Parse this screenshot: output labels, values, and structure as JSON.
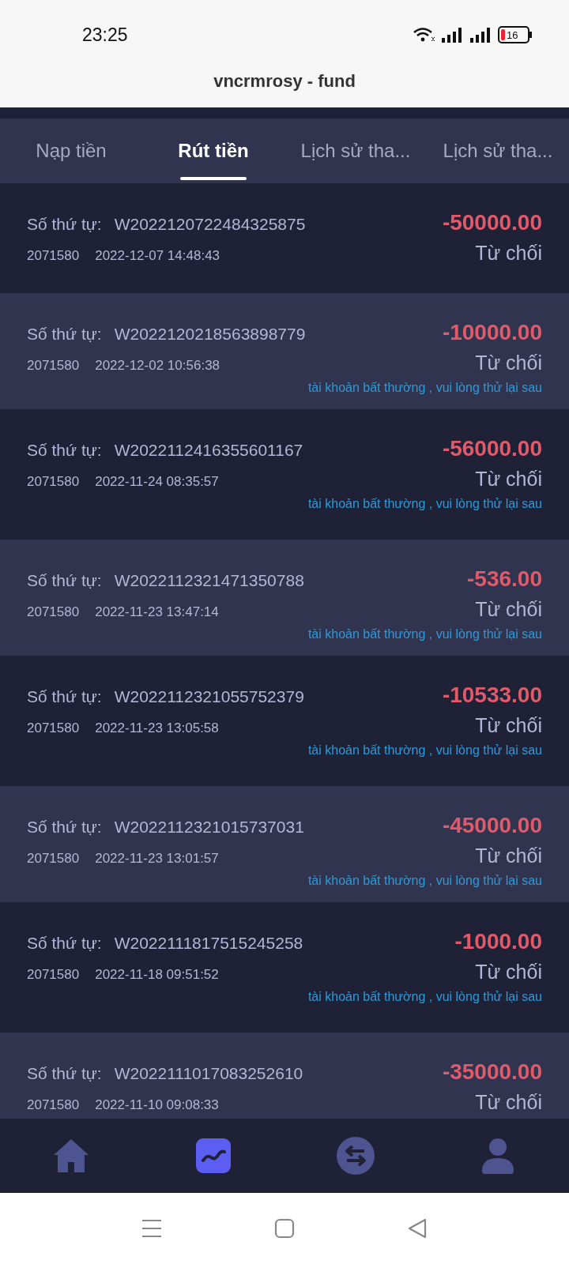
{
  "status_bar": {
    "time": "23:25",
    "battery": "16"
  },
  "header": {
    "title": "vncrmrosy - fund"
  },
  "tabs": [
    {
      "label": "Nạp tiền",
      "selected": false
    },
    {
      "label": "Rút tiền",
      "selected": true
    },
    {
      "label": "Lịch sử tha...",
      "selected": false
    },
    {
      "label": "Lịch sử tha...",
      "selected": false
    }
  ],
  "records": [
    {
      "order_label": "Số thứ tự:",
      "order_no": "W2022120722484325875",
      "user_id": "2071580",
      "time": "2022-12-07 14:48:43",
      "amount": "-50000.00",
      "status": "Từ chối"
    },
    {
      "order_label": "Số thứ tự:",
      "order_no": "W2022120218563898779",
      "user_id": "2071580",
      "time": "2022-12-02 10:56:38",
      "amount": "-10000.00",
      "status": "Từ chối",
      "note": "tài khoản bất thường , vui lòng thử lại sau"
    },
    {
      "order_label": "Số thứ tự:",
      "order_no": "W2022112416355601167",
      "user_id": "2071580",
      "time": "2022-11-24 08:35:57",
      "amount": "-56000.00",
      "status": "Từ chối",
      "note": "tài khoản bất thường , vui lòng thử lại sau"
    },
    {
      "order_label": "Số thứ tự:",
      "order_no": "W2022112321471350788",
      "user_id": "2071580",
      "time": "2022-11-23 13:47:14",
      "amount": "-536.00",
      "status": "Từ chối",
      "note": "tài khoản bất thường , vui lòng thử lại sau"
    },
    {
      "order_label": "Số thứ tự:",
      "order_no": "W2022112321055752379",
      "user_id": "2071580",
      "time": "2022-11-23 13:05:58",
      "amount": "-10533.00",
      "status": "Từ chối",
      "note": "tài khoản bất thường , vui lòng thử lại sau"
    },
    {
      "order_label": "Số thứ tự:",
      "order_no": "W2022112321015737031",
      "user_id": "2071580",
      "time": "2022-11-23 13:01:57",
      "amount": "-45000.00",
      "status": "Từ chối",
      "note": "tài khoản bất thường , vui lòng thử lại sau"
    },
    {
      "order_label": "Số thứ tự:",
      "order_no": "W2022111817515245258",
      "user_id": "2071580",
      "time": "2022-11-18 09:51:52",
      "amount": "-1000.00",
      "status": "Từ chối",
      "note": "tài khoản bất thường , vui lòng thử lại sau"
    },
    {
      "order_label": "Số thứ tự:",
      "order_no": "W2022111017083252610",
      "user_id": "2071580",
      "time": "2022-11-10 09:08:33",
      "amount": "-35000.00",
      "status": "Từ chối"
    }
  ],
  "bottom_nav": [
    {
      "kind": "home",
      "selected": false
    },
    {
      "kind": "chart",
      "selected": true
    },
    {
      "kind": "exchange",
      "selected": false
    },
    {
      "kind": "profile",
      "selected": false
    }
  ]
}
